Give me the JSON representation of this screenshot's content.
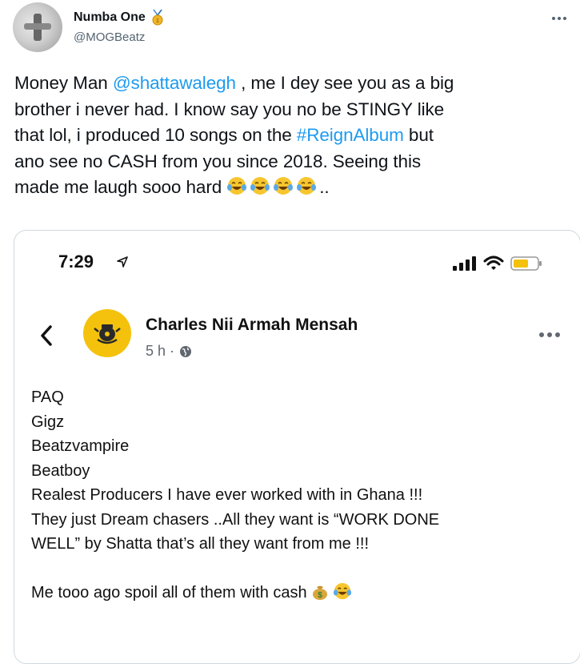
{
  "author": {
    "display_name": "Numba One",
    "handle": "@MOGBeatz"
  },
  "tweet": {
    "line1_prefix": "Money Man ",
    "mention": "@shattawalegh",
    "line1_suffix": " , me I dey see you as a big",
    "line2": "brother i never had. I know say you no be STINGY like",
    "line3_prefix": "that lol, i produced 10 songs on the ",
    "hashtag": "#ReignAlbum",
    "line3_suffix": " but",
    "line4": "ano see no CASH from you since 2018. Seeing this",
    "line5_prefix": "made me laugh sooo hard ",
    "line5_suffix": "..",
    "emojis": [
      "face-with-tears-of-joy",
      "face-with-tears-of-joy",
      "face-with-tears-of-joy",
      "face-with-tears-of-joy"
    ]
  },
  "screenshot": {
    "status_time": "7:29",
    "page_name": "Charles Nii Armah Mensah",
    "post_time": "5 h ·",
    "post_lines": [
      "PAQ",
      "Gigz",
      "Beatzvampire",
      "Beatboy",
      "Realest Producers I have ever worked with in Ghana !!!",
      "They just Dream chasers ..All they want is “WORK DONE",
      "WELL” by Shatta that’s all they want from me !!!",
      "",
      "Me tooo ago spoil all of them with cash"
    ],
    "last_line_emojis": [
      "money-bag",
      "face-with-tears-of-joy"
    ]
  },
  "colors": {
    "link": "#1d9bf0",
    "battery": "#f4c20d",
    "page_avatar": "#f4c20d"
  }
}
